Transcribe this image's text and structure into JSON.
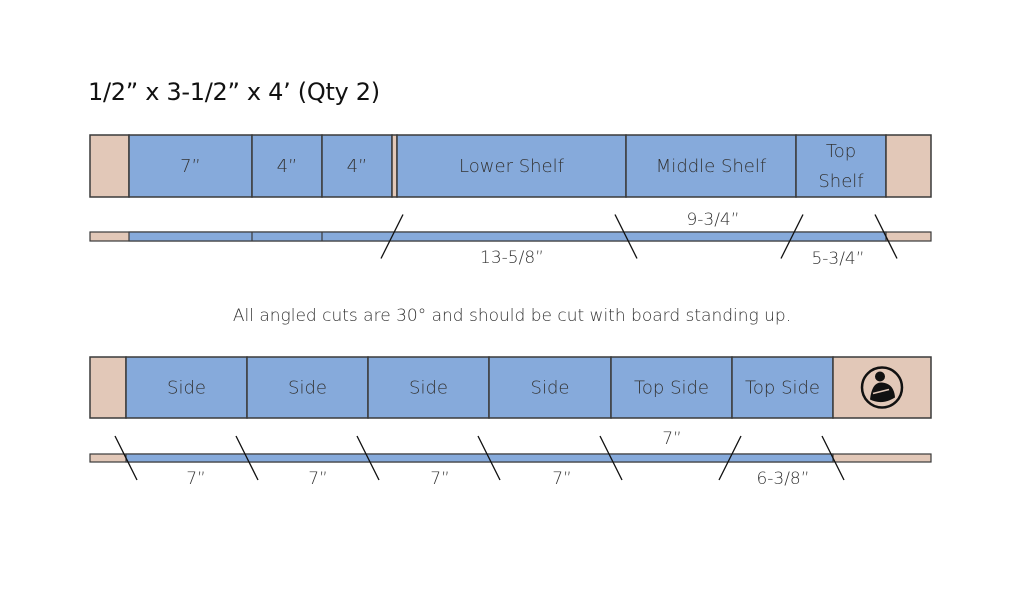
{
  "title": "1/2” x 3-1/2” x 4’ (Qty 2)",
  "note": "All angled cuts are 30° and should be cut with board standing up.",
  "colors": {
    "piece": "#86aadb",
    "waste": "#e2c8b8",
    "outline": "#3a3a3a",
    "text": "#333333"
  },
  "boards": [
    {
      "name": "board-1",
      "segments": [
        {
          "type": "waste",
          "label": []
        },
        {
          "type": "piece",
          "label": [
            "7”"
          ]
        },
        {
          "type": "piece",
          "label": [
            "4”"
          ]
        },
        {
          "type": "piece",
          "label": [
            "4”"
          ]
        },
        {
          "type": "waste",
          "label": []
        },
        {
          "type": "piece",
          "label": [
            "Lower Shelf"
          ]
        },
        {
          "type": "piece",
          "label": [
            "Middle Shelf"
          ]
        },
        {
          "type": "piece",
          "label": [
            "Top",
            "Shelf"
          ]
        },
        {
          "type": "waste",
          "label": []
        }
      ],
      "strip_dimensions": [
        {
          "label": "13-5/8”",
          "position": "below"
        },
        {
          "label": "9-3/4”",
          "position": "above"
        },
        {
          "label": "5-3/4”",
          "position": "below"
        }
      ]
    },
    {
      "name": "board-2",
      "segments": [
        {
          "type": "waste",
          "label": []
        },
        {
          "type": "piece",
          "label": [
            "Side"
          ]
        },
        {
          "type": "piece",
          "label": [
            "Side"
          ]
        },
        {
          "type": "piece",
          "label": [
            "Side"
          ]
        },
        {
          "type": "piece",
          "label": [
            "Side"
          ]
        },
        {
          "type": "piece",
          "label": [
            "Top Side"
          ]
        },
        {
          "type": "piece",
          "label": [
            "Top Side"
          ]
        },
        {
          "type": "logo",
          "label": [],
          "icon": "woodworker-logo-icon"
        }
      ],
      "strip_dimensions": [
        {
          "label": "7”",
          "position": "below"
        },
        {
          "label": "7”",
          "position": "below"
        },
        {
          "label": "7”",
          "position": "below"
        },
        {
          "label": "7”",
          "position": "below"
        },
        {
          "label": "7”",
          "position": "above"
        },
        {
          "label": "6-3/8”",
          "position": "below"
        }
      ]
    }
  ]
}
